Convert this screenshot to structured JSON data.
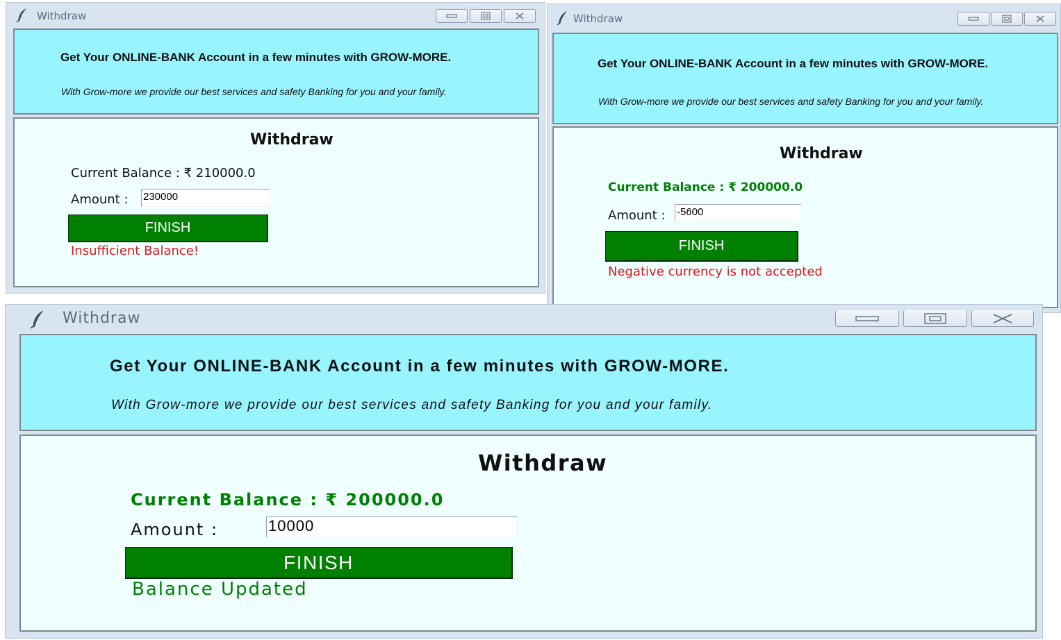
{
  "windows": [
    {
      "title": "Withdraw",
      "banner_title": "Get Your ONLINE-BANK Account in a few minutes with GROW-MORE.",
      "banner_subtitle": "With Grow-more we provide our best services and safety Banking for you and your family.",
      "heading": "Withdraw",
      "balance_text": "Current Balance :  ₹ 210000.0",
      "amount_label": "Amount :",
      "amount_value": "230000",
      "finish_label": "FINISH",
      "message": "Insufficient Balance!",
      "message_color": "#e0161a"
    },
    {
      "title": "Withdraw",
      "banner_title": "Get Your ONLINE-BANK Account in a few minutes with GROW-MORE.",
      "banner_subtitle": "With Grow-more we provide our best services and safety Banking for you and your family.",
      "heading": "Withdraw",
      "balance_text": "Current Balance : ₹ 200000.0",
      "amount_label": "Amount :",
      "amount_value": "-5600",
      "finish_label": "FINISH",
      "message": "Negative currency is not accepted",
      "message_color": "#e0161a"
    },
    {
      "title": "Withdraw",
      "banner_title": "Get Your ONLINE-BANK Account in a few minutes with GROW-MORE.",
      "banner_subtitle": "With Grow-more we provide our best services and safety Banking for you and your family.",
      "heading": "Withdraw",
      "balance_text": "Current Balance : ₹ 200000.0",
      "amount_label": "Amount :",
      "amount_value": "10000",
      "finish_label": "FINISH",
      "message": "Balance Updated",
      "message_color": "#008000"
    }
  ],
  "colors": {
    "banner_bg": "#98f5ff",
    "panel_bg": "#f0ffff",
    "button_bg": "#008000",
    "balance_green": "#008000",
    "error_red": "#e0161a"
  },
  "icons": [
    "feather-icon",
    "minimize-icon",
    "maximize-icon",
    "close-icon"
  ]
}
